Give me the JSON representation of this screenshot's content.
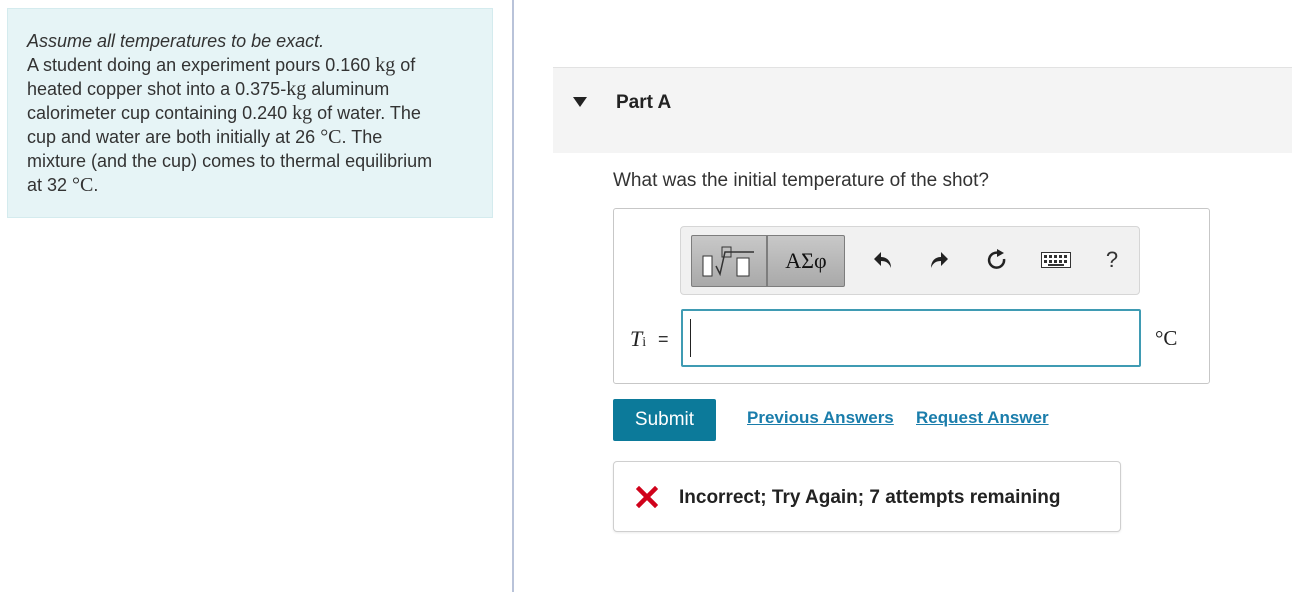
{
  "problem": {
    "note": "Assume all temperatures to be exact.",
    "line1_pre": "A student doing an experiment pours 0.160 ",
    "line1_unit": "kg",
    "line1_post": " of",
    "line2_pre": "heated copper shot into a 0.375-",
    "line2_unit": "kg",
    "line2_post": " aluminum",
    "line3_pre": "calorimeter cup containing 0.240 ",
    "line3_unit": "kg",
    "line3_post": " of water. The",
    "line4_pre": "cup and water are both initially at 26 ",
    "line4_unit": "°C",
    "line4_post": ". The",
    "line5": "mixture (and the cup) comes to thermal equilibrium",
    "line6_pre": "at 32 ",
    "line6_unit": "°C",
    "line6_post": "."
  },
  "part": {
    "title": "Part A",
    "question": "What was the initial temperature of the shot?"
  },
  "toolbar": {
    "symbols_label": "ΑΣφ",
    "help_label": "?"
  },
  "answer": {
    "variable": "T",
    "subscript": "i",
    "equals": "=",
    "value": "",
    "unit": "°C"
  },
  "actions": {
    "submit_label": "Submit",
    "previous_answers_label": "Previous Answers",
    "request_answer_label": "Request Answer"
  },
  "feedback": {
    "message": "Incorrect; Try Again; 7 attempts remaining",
    "status_color": "#d0021b"
  },
  "colors": {
    "problem_bg": "#e6f4f6",
    "submit_bg": "#0c7a9a",
    "link": "#1a7dab",
    "input_border": "#3f9bb3"
  }
}
